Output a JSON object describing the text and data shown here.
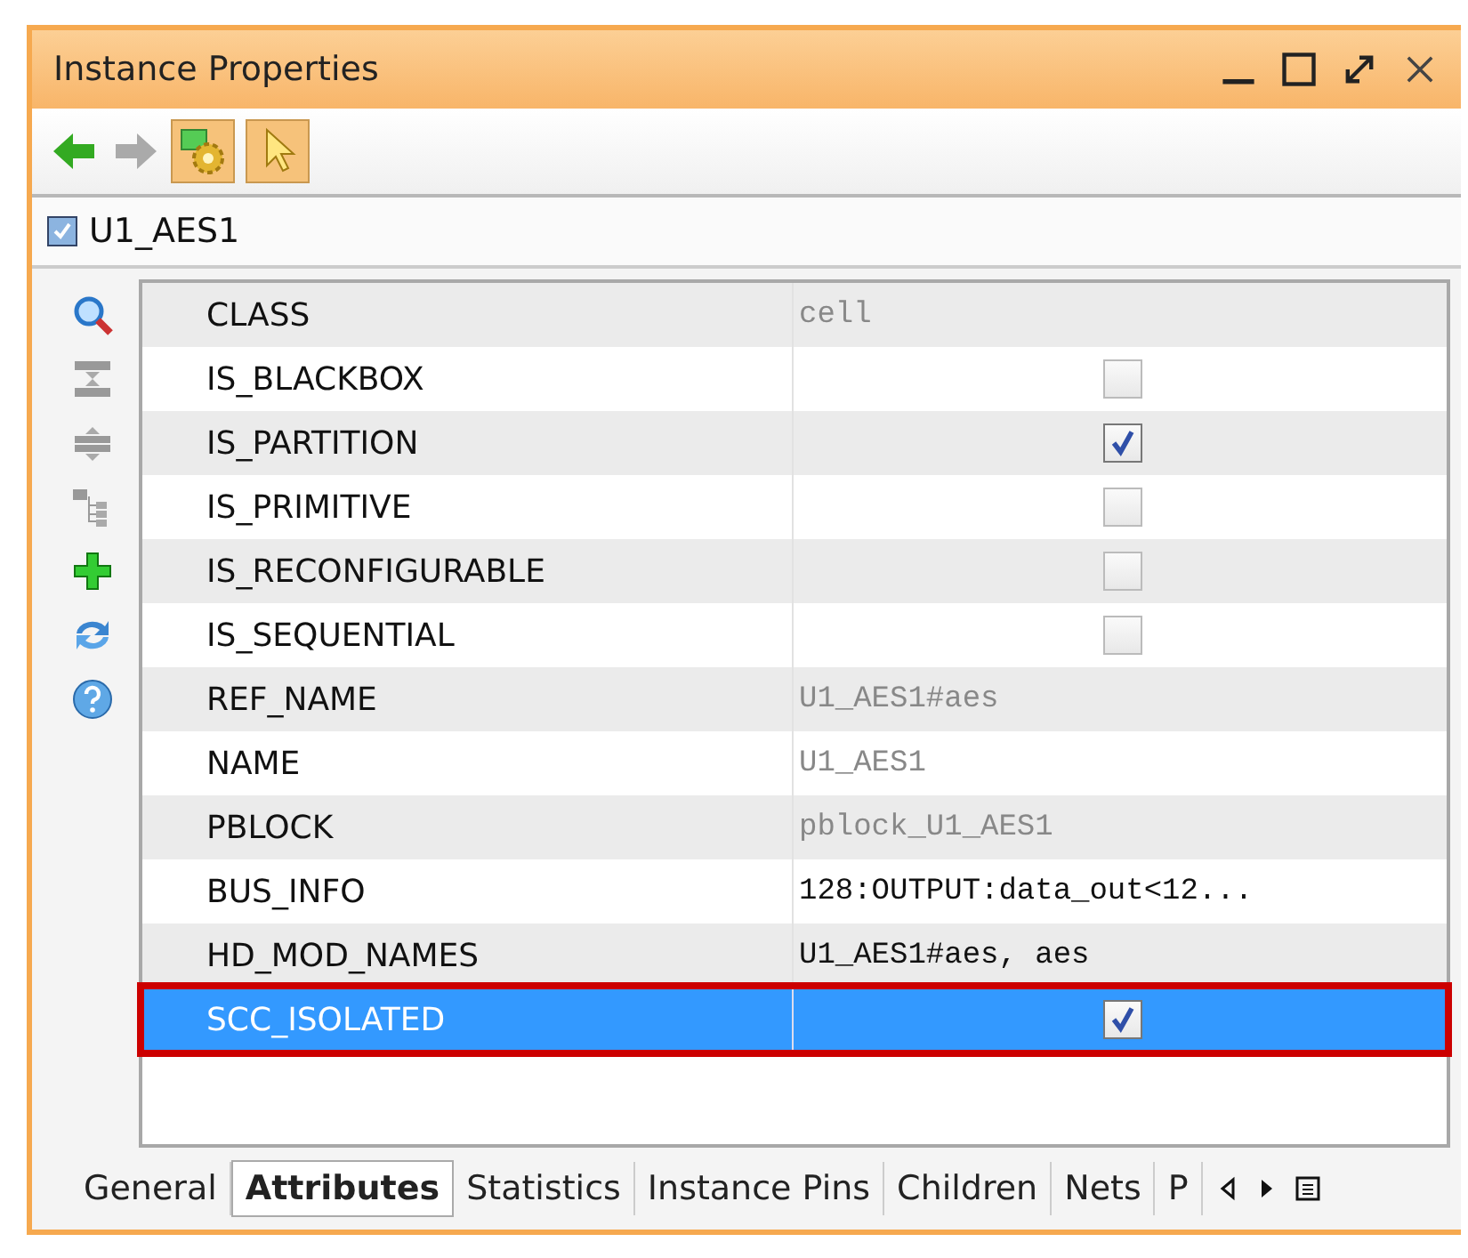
{
  "window": {
    "title": "Instance Properties"
  },
  "object": {
    "name": "U1_AES1"
  },
  "properties": [
    {
      "name": "CLASS",
      "kind": "text",
      "value": "cell",
      "readonly": true,
      "selected": false
    },
    {
      "name": "IS_BLACKBOX",
      "kind": "checkbox",
      "checked": false,
      "selected": false
    },
    {
      "name": "IS_PARTITION",
      "kind": "checkbox",
      "checked": true,
      "selected": false
    },
    {
      "name": "IS_PRIMITIVE",
      "kind": "checkbox",
      "checked": false,
      "selected": false
    },
    {
      "name": "IS_RECONFIGURABLE",
      "kind": "checkbox",
      "checked": false,
      "selected": false
    },
    {
      "name": "IS_SEQUENTIAL",
      "kind": "checkbox",
      "checked": false,
      "selected": false
    },
    {
      "name": "REF_NAME",
      "kind": "text",
      "value": "U1_AES1#aes",
      "readonly": true,
      "selected": false
    },
    {
      "name": "NAME",
      "kind": "text",
      "value": "U1_AES1",
      "readonly": true,
      "selected": false
    },
    {
      "name": "PBLOCK",
      "kind": "text",
      "value": "pblock_U1_AES1",
      "readonly": true,
      "selected": false
    },
    {
      "name": "BUS_INFO",
      "kind": "text",
      "value": "128:OUTPUT:data_out<12...",
      "readonly": false,
      "selected": false
    },
    {
      "name": "HD_MOD_NAMES",
      "kind": "text",
      "value": "U1_AES1#aes, aes",
      "readonly": false,
      "selected": false
    },
    {
      "name": "SCC_ISOLATED",
      "kind": "checkbox",
      "checked": true,
      "selected": true
    }
  ],
  "tabs": [
    {
      "label": "General",
      "selected": false
    },
    {
      "label": "Attributes",
      "selected": true
    },
    {
      "label": "Statistics",
      "selected": false
    },
    {
      "label": "Instance Pins",
      "selected": false
    },
    {
      "label": "Children",
      "selected": false
    },
    {
      "label": "Nets",
      "selected": false
    },
    {
      "label": "P",
      "selected": false
    }
  ]
}
